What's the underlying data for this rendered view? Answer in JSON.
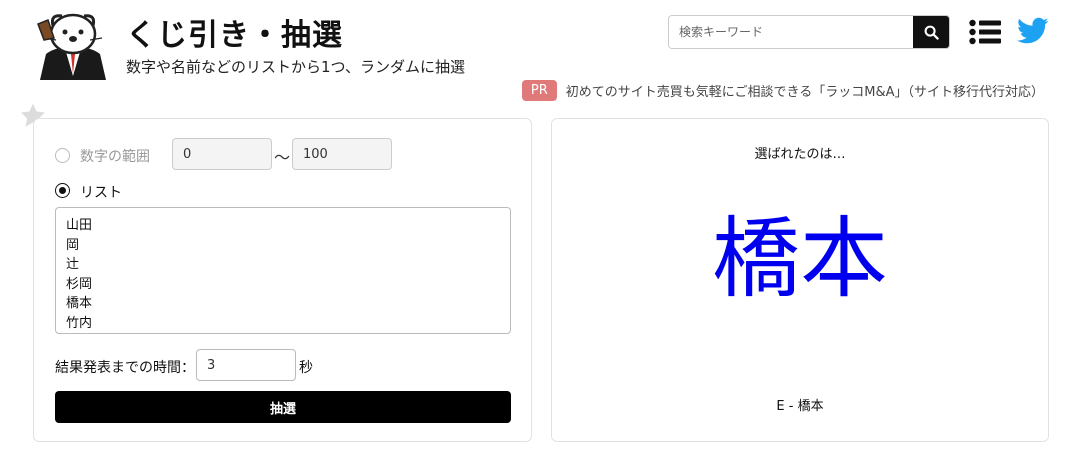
{
  "header": {
    "title": "くじ引き・抽選",
    "subtitle": "数字や名前などのリストから1つ、ランダムに抽選"
  },
  "search": {
    "placeholder": "検索キーワード",
    "button_icon": "search-icon"
  },
  "nav": {
    "menu_icon": "list-menu-icon",
    "social_icon": "twitter-icon"
  },
  "ad": {
    "badge": "PR",
    "text": "初めてのサイト売買も気軽にご相談できる「ラッコM&A」（サイト移行代行対応）"
  },
  "form": {
    "mode_range_label": "数字の範囲",
    "range_from": "0",
    "range_tilde": "〜",
    "range_to": "100",
    "mode_list_label": "リスト",
    "selected_mode": "list",
    "list_items": [
      "山田",
      "岡",
      "辻",
      "杉岡",
      "橋本",
      "竹内"
    ],
    "time_label": "結果発表までの時間：",
    "time_value": "3",
    "time_unit": "秒",
    "draw_button": "抽選"
  },
  "result": {
    "caption": "選ばれたのは…",
    "name": "橋本",
    "detail": "E - 橋本"
  },
  "colors": {
    "accent_result": "#0000ee",
    "pr_badge": "#e07a7a",
    "twitter": "#1da1f2",
    "button_bg": "#000000"
  }
}
